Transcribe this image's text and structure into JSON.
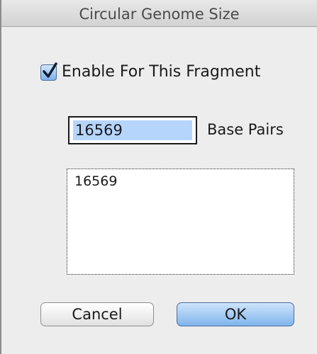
{
  "window": {
    "title": "Circular Genome Size"
  },
  "checkbox": {
    "label": "Enable For This Fragment",
    "checked": true
  },
  "size_field": {
    "value": "16569",
    "unit_label": "Base Pairs"
  },
  "list": {
    "items": [
      "16569"
    ]
  },
  "buttons": {
    "cancel_label": "Cancel",
    "ok_label": "OK"
  },
  "colors": {
    "accent": "#7fb4ec",
    "selection": "#b6d5fd"
  }
}
